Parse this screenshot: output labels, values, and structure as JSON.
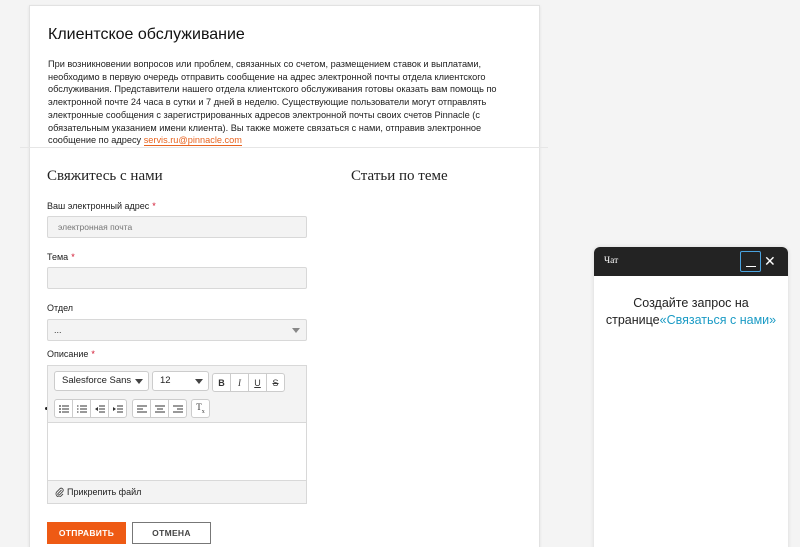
{
  "info": {
    "title": "Клиентское обслуживание",
    "text_before_link": "При возникновении вопросов или проблем, связанных со счетом, размещением ставок и выплатами, необходимо в первую очередь отправить сообщение на адрес электронной почты отдела клиентского обслуживания. Представители нашего отдела клиентского обслуживания готовы оказать вам помощь по электронной почте 24 часа в сутки и 7 дней в неделю. Существующие пользователи могут отправлять электронные сообщения с зарегистрированных адресов электронной почты своих счетов Pinnacle (с обязательным указанием имени клиента). Вы также можете связаться с нами, отправив электронное сообщение по адресу",
    "email": "servis.ru@pinnacle.com"
  },
  "form": {
    "heading": "Свяжитесь с нами",
    "email_label": "Ваш электронный адрес",
    "email_placeholder": "электронная почта",
    "subject_label": "Тема",
    "subject_value": "",
    "department_label": "Отдел",
    "department_value": "...",
    "description_label": "Описание",
    "required_mark": "*",
    "editor": {
      "font_family": "Salesforce Sans",
      "font_size": "12",
      "attach_label": "Прикрепить файл"
    },
    "submit_label": "ОТПРАВИТЬ",
    "cancel_label": "ОТМЕНА"
  },
  "articles": {
    "heading": "Статьи по теме"
  },
  "chat": {
    "title": "Чат",
    "message_line1": "Создайте запрос на",
    "message_prefix": "странице",
    "message_link": "«Связаться с нами»"
  },
  "colors": {
    "accent": "#ee5a14",
    "link_blue": "#1b9bc5",
    "chat_header": "#232323",
    "required": "#d0112b"
  }
}
